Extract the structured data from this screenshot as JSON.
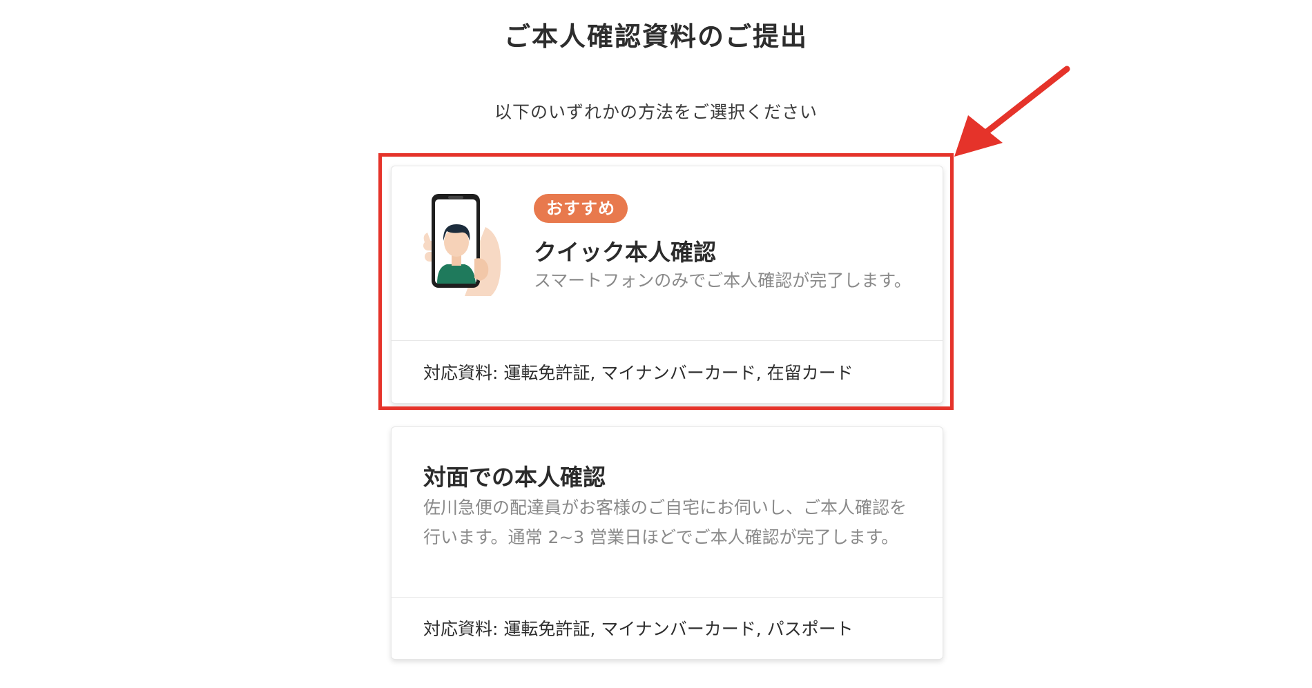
{
  "header": {
    "title": "ご本人確認資料のご提出",
    "subtitle": "以下のいずれかの方法をご選択ください"
  },
  "options": [
    {
      "badge": "おすすめ",
      "title": "クイック本人確認",
      "description": "スマートフォンのみでご本人確認が完了します。",
      "documents": "対応資料: 運転免許証, マイナンバーカード, 在留カード",
      "illustration": "phone-selfie-icon"
    },
    {
      "title": "対面での本人確認",
      "description": "佐川急便の配達員がお客様のご自宅にお伺いし、ご本人確認を行います。通常 2~3 営業日ほどでご本人確認が完了します。",
      "documents": "対応資料: 運転免許証, マイナンバーカード, パスポート"
    }
  ],
  "annotation": {
    "highlight_color": "#e5332a",
    "arrow_icon": "red-arrow-icon"
  },
  "colors": {
    "badge": "#e8794d",
    "description_text": "#8a8a8a"
  }
}
